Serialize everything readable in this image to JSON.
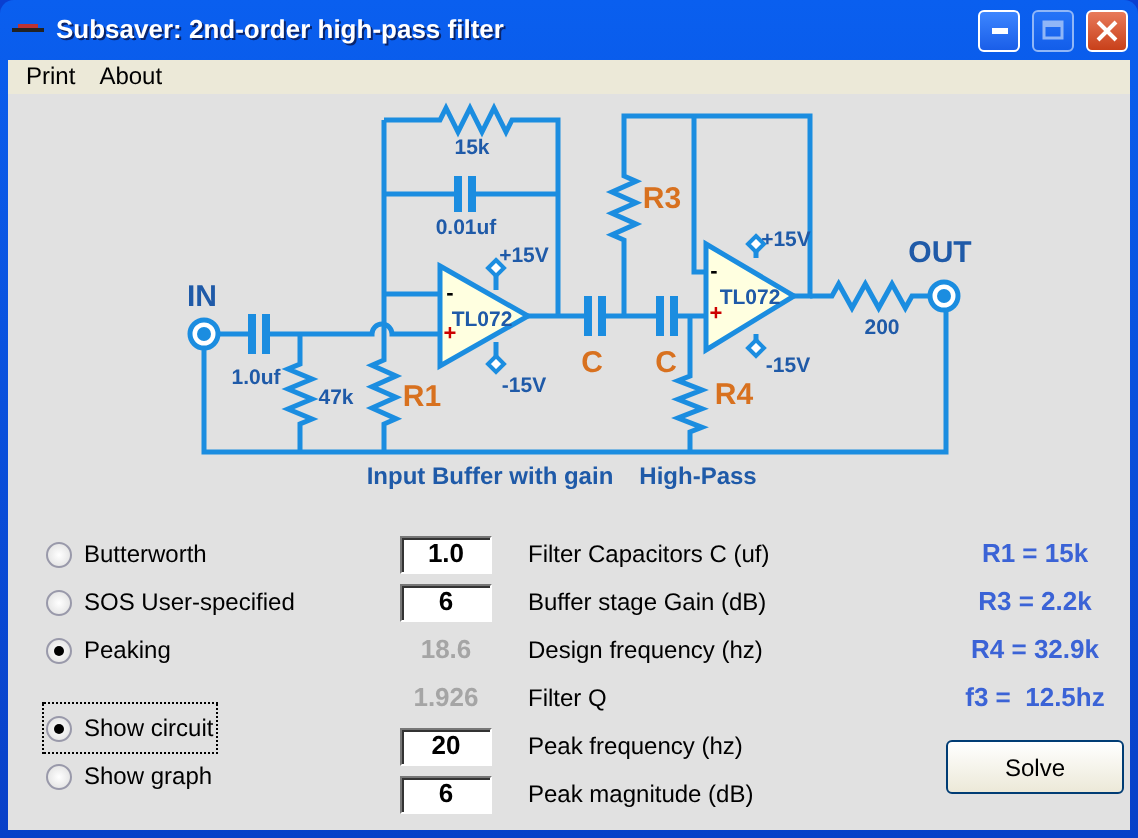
{
  "window": {
    "title": "Subsaver: 2nd-order high-pass filter"
  },
  "menu": [
    {
      "label": "Print"
    },
    {
      "label": "About"
    }
  ],
  "circuit": {
    "labels": [
      {
        "text": "IN",
        "kind": "port"
      },
      {
        "text": "OUT",
        "kind": "port"
      },
      {
        "text": "15k",
        "kind": "value"
      },
      {
        "text": "0.01uf",
        "kind": "value"
      },
      {
        "text": "-",
        "kind": "pin"
      },
      {
        "text": "+",
        "kind": "pin-plus"
      },
      {
        "text": "+15V",
        "kind": "value"
      },
      {
        "text": "TL072",
        "kind": "value"
      },
      {
        "text": "-15V",
        "kind": "value"
      },
      {
        "text": "1.0uf",
        "kind": "value"
      },
      {
        "text": "47k",
        "kind": "value"
      },
      {
        "text": "R1",
        "kind": "part"
      },
      {
        "text": "R3",
        "kind": "part"
      },
      {
        "text": "C",
        "kind": "part"
      },
      {
        "text": "C",
        "kind": "part"
      },
      {
        "text": "-",
        "kind": "pin"
      },
      {
        "text": "+",
        "kind": "pin-plus"
      },
      {
        "text": "+15V",
        "kind": "value"
      },
      {
        "text": "TL072",
        "kind": "value"
      },
      {
        "text": "-15V",
        "kind": "value"
      },
      {
        "text": "R4",
        "kind": "part"
      },
      {
        "text": "200",
        "kind": "value"
      },
      {
        "text": "Input Buffer with gain",
        "kind": "caption"
      },
      {
        "text": "High-Pass",
        "kind": "caption"
      }
    ]
  },
  "filter_types": [
    {
      "label": "Butterworth",
      "selected": false
    },
    {
      "label": "SOS User-specified",
      "selected": false
    },
    {
      "label": "Peaking",
      "selected": true
    }
  ],
  "view_options": [
    {
      "label": "Show circuit",
      "selected": true,
      "focused": true
    },
    {
      "label": "Show graph",
      "selected": false,
      "focused": false
    }
  ],
  "parameters": [
    {
      "kind": "input",
      "value": "1.0",
      "label": "Filter Capacitors C (uf)"
    },
    {
      "kind": "input",
      "value": "6",
      "label": "Buffer stage Gain (dB)"
    },
    {
      "kind": "computed",
      "value": "18.6",
      "label": "Design frequency (hz)"
    },
    {
      "kind": "computed",
      "value": "1.926",
      "label": "Filter Q"
    },
    {
      "kind": "input",
      "value": "20",
      "label": "Peak frequency (hz)"
    },
    {
      "kind": "input",
      "value": "6",
      "label": "Peak magnitude (dB)"
    }
  ],
  "results": [
    "R1 = 15k",
    "R3 = 2.2k",
    "R4 = 32.9k",
    "f3 =  12.5hz"
  ],
  "buttons": [
    {
      "label": "Solve"
    }
  ]
}
